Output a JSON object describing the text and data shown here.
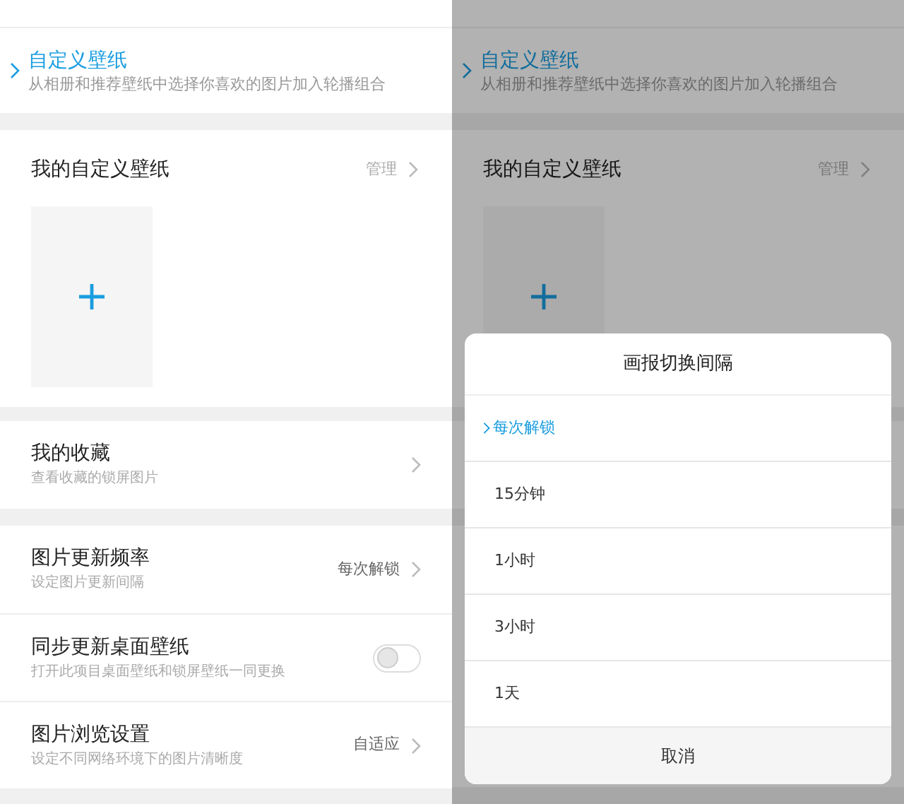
{
  "left_screen": {
    "custom_wallpaper": {
      "title": "自定义壁纸",
      "subtitle": "从相册和推荐壁纸中选择你喜欢的图片加入轮播组合"
    },
    "my_wallpapers": {
      "title": "我的自定义壁纸",
      "action": "管理"
    },
    "favorites": {
      "title": "我的收藏",
      "subtitle": "查看收藏的锁屏图片"
    },
    "settings": [
      {
        "kind": "value",
        "title": "图片更新频率",
        "subtitle": "设定图片更新间隔",
        "value": "每次解锁"
      },
      {
        "kind": "switch",
        "title": "同步更新桌面壁纸",
        "subtitle": "打开此项目桌面壁纸和锁屏壁纸一同更换",
        "on": false
      },
      {
        "kind": "value",
        "title": "图片浏览设置",
        "subtitle": "设定不同网络环境下的图片清晰度",
        "value": "自适应"
      }
    ]
  },
  "right_screen": {
    "custom_wallpaper": {
      "title": "自定义壁纸",
      "subtitle": "从相册和推荐壁纸中选择你喜欢的图片加入轮播组合"
    },
    "my_wallpapers": {
      "title": "我的自定义壁纸",
      "action": "管理"
    },
    "dialog": {
      "title": "画报切换间隔",
      "options": [
        {
          "label": "每次解锁",
          "selected": true
        },
        {
          "label": "15分钟",
          "selected": false
        },
        {
          "label": "1小时",
          "selected": false
        },
        {
          "label": "3小时",
          "selected": false
        },
        {
          "label": "1天",
          "selected": false
        }
      ],
      "cancel": "取消"
    }
  }
}
